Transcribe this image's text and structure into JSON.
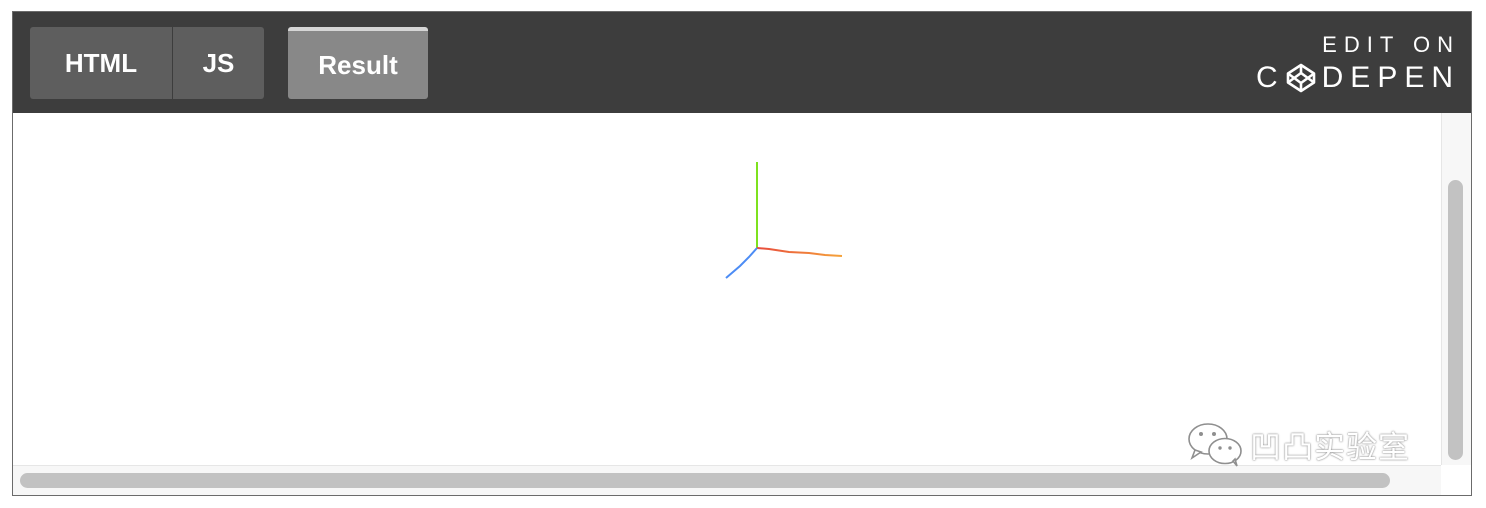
{
  "toolbar": {
    "tabs": [
      {
        "label": "HTML"
      },
      {
        "label": "JS"
      },
      {
        "label": "Result"
      }
    ],
    "active_tab": "Result",
    "edit_on": {
      "line1": "EDIT ON",
      "brand_prefix": "C",
      "brand_suffix": "DEPEN",
      "brand_icon": "codepen-cube-icon"
    }
  },
  "scene": {
    "axes": [
      {
        "name": "x",
        "color": "#e84a3c",
        "end_color": "#f5a33a"
      },
      {
        "name": "y",
        "color": "#7ee21e"
      },
      {
        "name": "z",
        "color": "#4c8cf5"
      }
    ]
  },
  "watermark": {
    "text": "凹凸实验室",
    "icon": "wechat-icon"
  },
  "colors": {
    "toolbar_bg": "#3d3d3d",
    "tab_bg": "#5e5e5e",
    "tab_active_bg": "#888888",
    "scrollbar_thumb": "#c2c2c2"
  }
}
